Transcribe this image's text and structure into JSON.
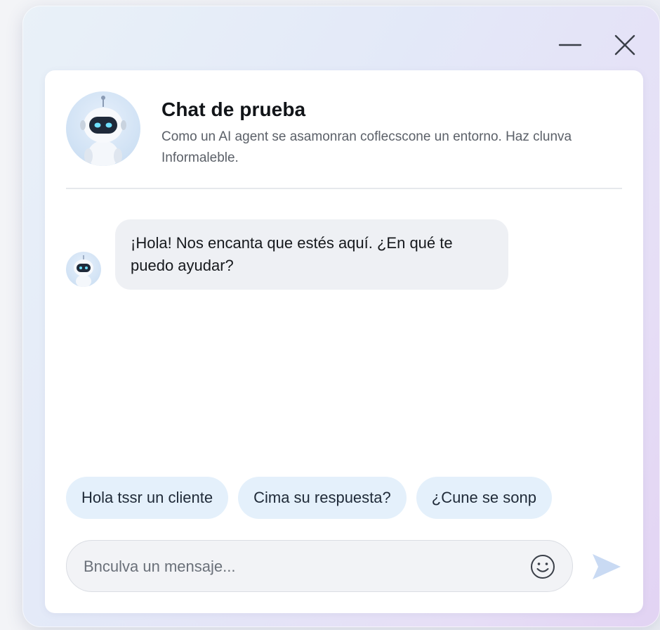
{
  "window": {
    "minimize_icon": "minus-icon",
    "close_icon": "close-icon"
  },
  "header": {
    "avatar_icon": "robot-icon",
    "title": "Chat de prueba",
    "subtitle": "Como un AI agent se asamonran coflecscone un entorno. Haz clunva Informaleble."
  },
  "messages": [
    {
      "sender": "bot",
      "avatar_icon": "robot-icon",
      "text": "¡Hola! Nos encanta que estés aquí. ¿En qué te puedo ayudar?"
    }
  ],
  "suggestions": [
    {
      "label": "Hola tssr un cliente"
    },
    {
      "label": "Cima su respuesta?"
    },
    {
      "label": "¿Cune se sonp"
    }
  ],
  "composer": {
    "placeholder": "Bnculva un mensaje...",
    "value": "",
    "emoji_icon": "smiley-icon",
    "send_icon": "send-icon"
  },
  "colors": {
    "accent": "#3b82f6",
    "chip_bg": "#e4f0fb",
    "bubble_bg": "#eef0f4",
    "send_icon": "#c9daf3"
  }
}
